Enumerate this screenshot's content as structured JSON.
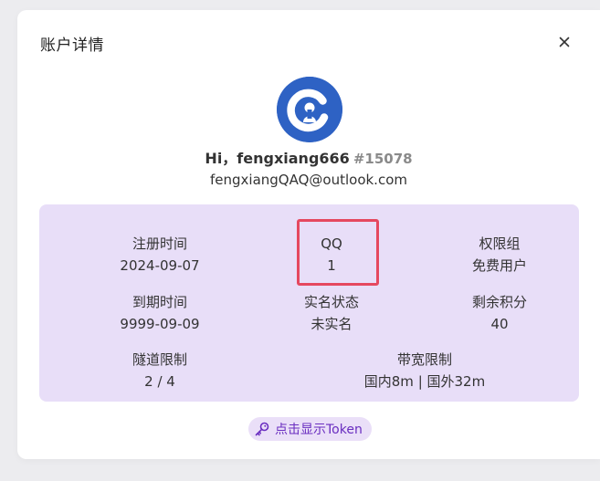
{
  "modal": {
    "title": "账户详情",
    "close_icon": "close-icon"
  },
  "profile": {
    "avatar_icon": "brand-logo-avatar",
    "greeting": "Hi，fengxiang666",
    "user_id": "#15078",
    "email": "fengxiangQAQ@outlook.com"
  },
  "info": {
    "register_time": {
      "label": "注册时间",
      "value": "2024-09-07"
    },
    "qq": {
      "label": "QQ",
      "value": "1"
    },
    "permission_group": {
      "label": "权限组",
      "value": "免费用户"
    },
    "expire_time": {
      "label": "到期时间",
      "value": "9999-09-09"
    },
    "realname_status": {
      "label": "实名状态",
      "value": "未实名"
    },
    "remaining_points": {
      "label": "剩余积分",
      "value": "40"
    },
    "tunnel_limit": {
      "label": "隧道限制",
      "value": "2 / 4"
    },
    "bandwidth_limit": {
      "label": "带宽限制",
      "value": "国内8m | 国外32m"
    }
  },
  "token_button": {
    "label": "点击显示Token",
    "icon": "key-icon"
  },
  "colors": {
    "accent": "#6a2ec0",
    "panel_bg": "#e8def8",
    "highlight_border": "#e5485f",
    "avatar_bg": "#2e62c4"
  }
}
